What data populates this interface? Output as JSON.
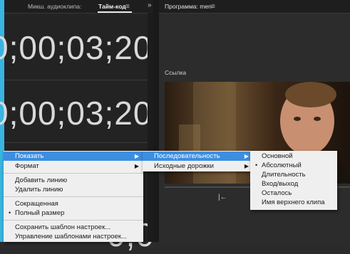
{
  "left": {
    "tabs": [
      "Микш. аудиоклипа:",
      "Тайм-код"
    ],
    "menu_icon": "hamburger-icon",
    "timecode_1": "0;00;03;20",
    "timecode_2": "0;00;03;20",
    "timecode_3": "0;0"
  },
  "right": {
    "title": "Программа: men",
    "menu_icon": "hamburger-icon",
    "section_label": "Ссылка",
    "transport_icon": "step-back-icon"
  },
  "menu1": {
    "items": [
      {
        "label": "Показать",
        "submenu": true,
        "selected": true
      },
      {
        "label": "Формат",
        "submenu": true
      },
      {
        "label": "Добавить линию"
      },
      {
        "label": "Удалить линию"
      },
      {
        "label": "Сокращенная"
      },
      {
        "label": "Полный размер",
        "checked": true
      },
      {
        "label": "Сохранить шаблон настроек..."
      },
      {
        "label": "Управление шаблонами настроек..."
      }
    ]
  },
  "menu2": {
    "items": [
      {
        "label": "Последовательность",
        "submenu": true,
        "selected": true
      },
      {
        "label": "Исходные дорожки",
        "submenu": true
      }
    ]
  },
  "menu3": {
    "items": [
      {
        "label": "Основной"
      },
      {
        "label": "Абсолютный",
        "checked": true
      },
      {
        "label": "Длительность"
      },
      {
        "label": "Вход/выход"
      },
      {
        "label": "Осталось"
      },
      {
        "label": "Имя верхнего клипа"
      }
    ]
  },
  "colors": {
    "accent": "#39b5e0",
    "highlight": "#3d8ee0",
    "menu_bg": "#efefef"
  }
}
